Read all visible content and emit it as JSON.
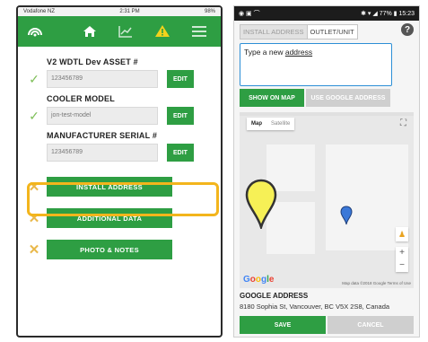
{
  "left": {
    "status": {
      "carrier": "Vodafone NZ",
      "time": "2:31 PM",
      "battery": "98%"
    },
    "toolbar": {
      "icons": [
        "signal-logo-icon",
        "home-icon",
        "chart-icon",
        "warning-icon",
        "menu-icon"
      ]
    },
    "fields": [
      {
        "label": "V2 WDTL Dev ASSET #",
        "value": "123456789",
        "edit": "EDIT"
      },
      {
        "label": "COOLER MODEL",
        "value": "jon-test-model",
        "edit": "EDIT"
      },
      {
        "label": "MANUFACTURER SERIAL #",
        "value": "123456789",
        "edit": "EDIT"
      }
    ],
    "actions": [
      "INSTALL ADDRESS",
      "ADDITIONAL DATA",
      "PHOTO & NOTES"
    ],
    "colors": {
      "primary": "#2e9e43",
      "highlight": "#f3b51c",
      "incomplete": "#e9b84a",
      "complete": "#7fbf5a"
    }
  },
  "right": {
    "status": {
      "battery": "77%",
      "time": "15:23"
    },
    "tabs": {
      "install": "INSTALL ADDRESS",
      "outlet": "OUTLET/UNIT"
    },
    "address_input": {
      "prefix": "Type a new ",
      "underlined": "address"
    },
    "buttons": {
      "show_map": "SHOW ON MAP",
      "use_google": "USE GOOGLE ADDRESS",
      "save": "SAVE",
      "cancel": "CANCEL"
    },
    "map": {
      "type_map": "Map",
      "type_satellite": "Satellite",
      "logo": "Google",
      "credit": "Map data ©2018 Google   Terms of Use",
      "zoom_in": "+",
      "zoom_out": "−"
    },
    "google_address": {
      "title": "GOOGLE ADDRESS",
      "value": "8180 Sophia St, Vancouver, BC V5X 2S8, Canada"
    }
  }
}
